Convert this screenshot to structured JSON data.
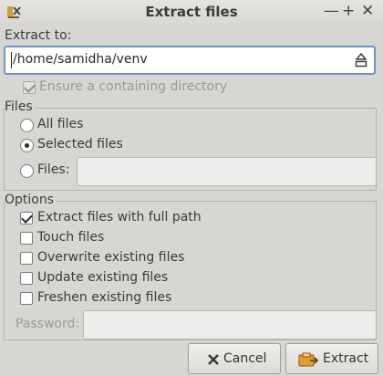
{
  "window": {
    "title": "Extract files",
    "minimize_glyph": "—",
    "maximize_glyph": "+",
    "close_glyph": "✕"
  },
  "extract_to": {
    "label": "Extract to:",
    "path_value": "/home/samidha/venv",
    "browse_icon": "eject-icon"
  },
  "ensure_dir": {
    "label": "Ensure a containing directory",
    "checked": true,
    "enabled": false
  },
  "files_group": {
    "title": "Files",
    "all_files": "All files",
    "selected_files": "Selected files",
    "files_pattern": "Files:",
    "selected_option": "selected_files",
    "pattern_value": ""
  },
  "options_group": {
    "title": "Options",
    "items": [
      {
        "label": "Extract files with full path",
        "checked": true
      },
      {
        "label": "Touch files",
        "checked": false
      },
      {
        "label": "Overwrite existing files",
        "checked": false
      },
      {
        "label": "Update existing files",
        "checked": false
      },
      {
        "label": "Freshen existing files",
        "checked": false
      }
    ],
    "password_label": "Password:",
    "password_value": ""
  },
  "buttons": {
    "cancel": "Cancel",
    "extract": "Extract"
  },
  "colors": {
    "window_bg": "#d7d6d3",
    "focus_border": "#6e94c8",
    "cancel_icon": "#3a3a3a",
    "extract_icon": "#e0a030"
  }
}
